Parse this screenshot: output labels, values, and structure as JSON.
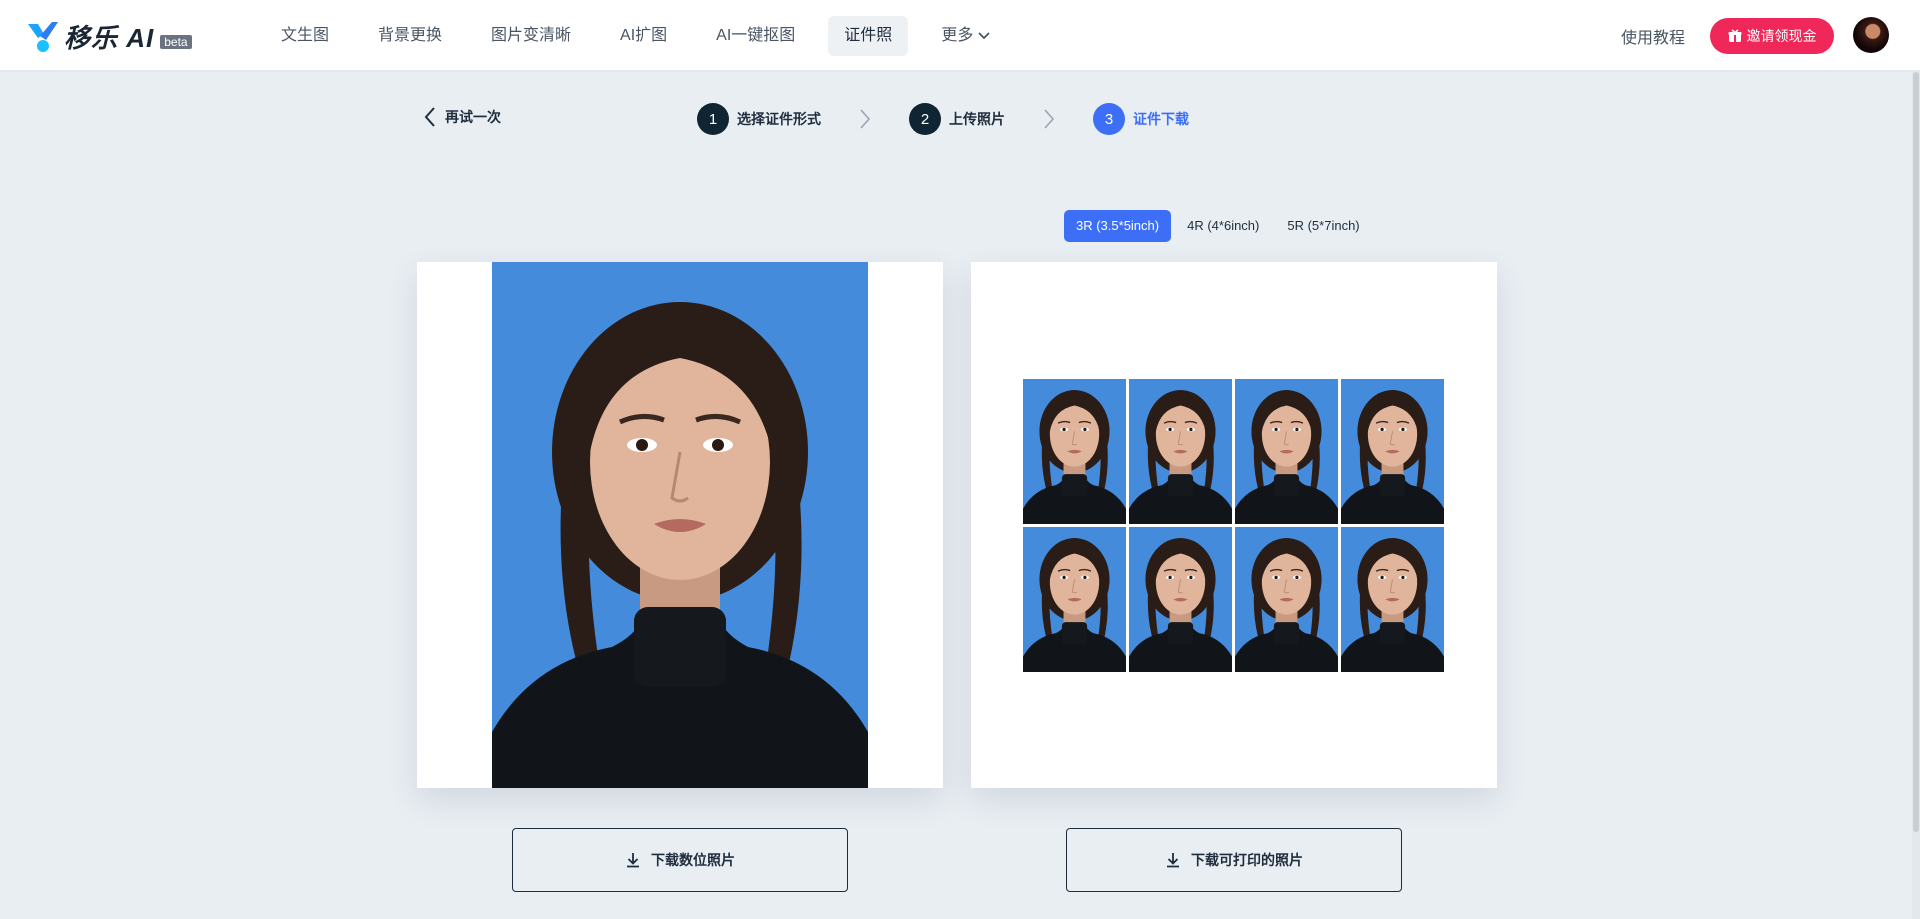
{
  "header": {
    "logo_text": "移乐 AI",
    "beta_badge": "beta",
    "nav": [
      {
        "label": "文生图"
      },
      {
        "label": "背景更换"
      },
      {
        "label": "图片变清晰"
      },
      {
        "label": "AI扩图"
      },
      {
        "label": "AI一键抠图"
      },
      {
        "label": "证件照",
        "active": true
      },
      {
        "label": "更多"
      }
    ],
    "tutorial": "使用教程",
    "invite_label": "邀请领现金"
  },
  "steps": {
    "back_label": "再试一次",
    "items": [
      {
        "num": "1",
        "label": "选择证件形式"
      },
      {
        "num": "2",
        "label": "上传照片"
      },
      {
        "num": "3",
        "label": "证件下载",
        "active": true
      }
    ]
  },
  "sizes": [
    {
      "label": "3R (3.5*5inch)",
      "selected": true
    },
    {
      "label": "4R (4*6inch)"
    },
    {
      "label": "5R (5*7inch)"
    }
  ],
  "downloads": {
    "digital": "下载数位照片",
    "printable": "下载可打印的照片"
  },
  "colors": {
    "accent": "#3d6ef6",
    "invite": "#f0285a",
    "photo_background": "#448cdb",
    "step_dark": "#0f2533"
  },
  "icons": {
    "back": "chevron-left-icon",
    "more": "chevron-down-icon",
    "step_separator": "chevron-right-icon",
    "invite": "gift-icon",
    "download": "download-icon"
  }
}
